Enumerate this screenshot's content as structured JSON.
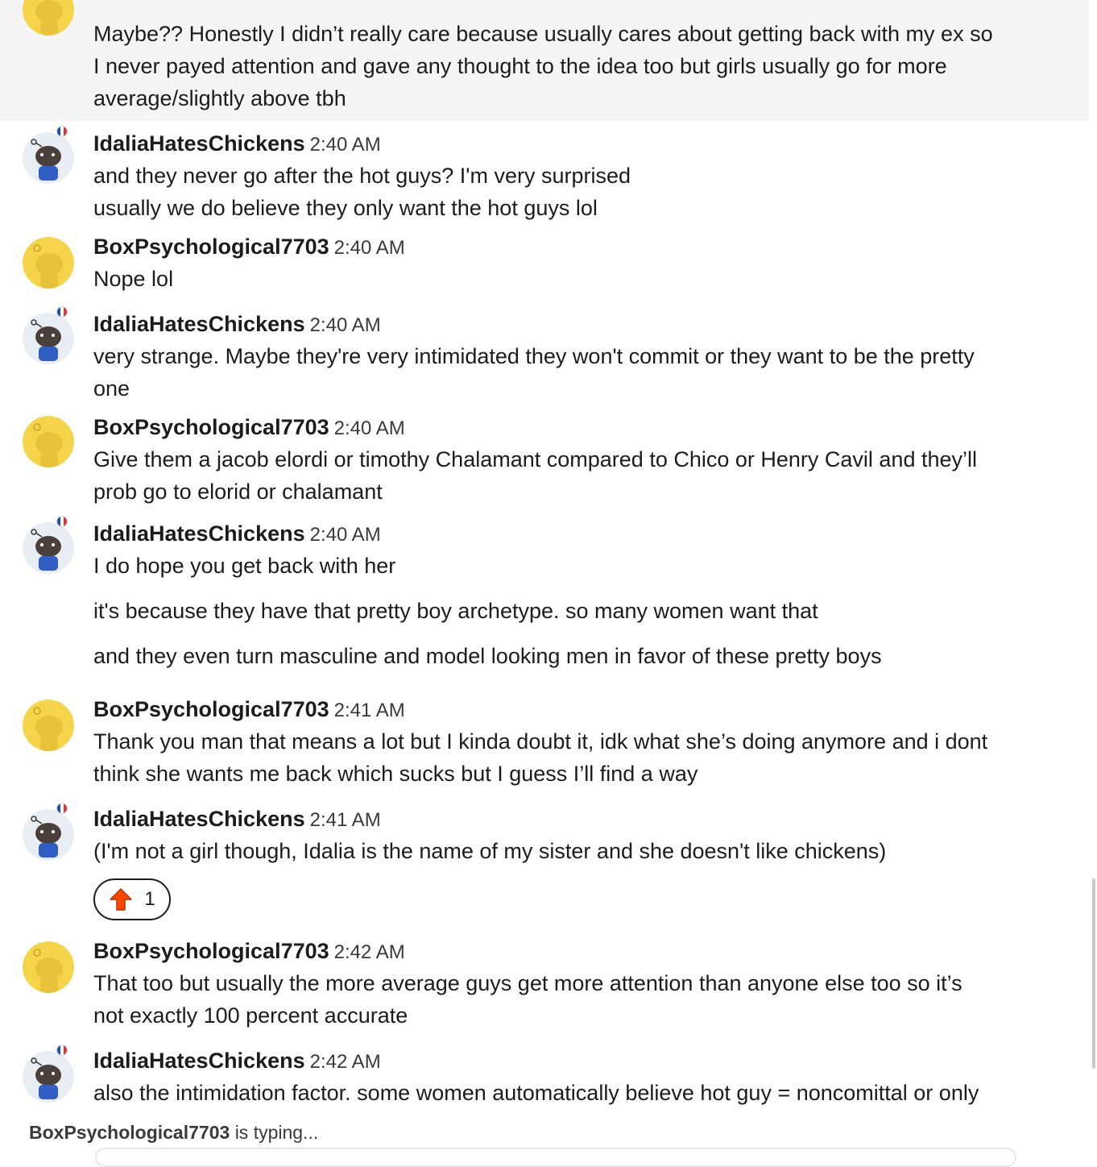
{
  "messages": [
    {
      "user": "",
      "time": "",
      "lines": [
        "Maybe?? Honestly I didn’t really care because usually cares about getting back with my ex so",
        "I never payed attention and gave any thought to the idea too but girls usually go for more",
        "average/slightly above tbh"
      ],
      "avatar": "yellow"
    },
    {
      "user": "IdaliaHatesChickens",
      "time": "2:40 AM",
      "lines": [
        "and they never go after the hot guys? I'm very surprised",
        "usually we do believe they only want the hot guys lol"
      ],
      "avatar": "bear"
    },
    {
      "user": "BoxPsychological7703",
      "time": "2:40 AM",
      "lines": [
        "Nope lol"
      ],
      "avatar": "yellow"
    },
    {
      "user": "IdaliaHatesChickens",
      "time": "2:40 AM",
      "lines": [
        "very strange. Maybe they're very intimidated they won't commit or they want to be the pretty",
        "one"
      ],
      "avatar": "bear"
    },
    {
      "user": "BoxPsychological7703",
      "time": "2:40 AM",
      "lines": [
        "Give them a jacob elordi or timothy Chalamant compared to Chico or Henry Cavil and they’ll",
        "prob go to elorid or chalamant"
      ],
      "avatar": "yellow"
    },
    {
      "user": "IdaliaHatesChickens",
      "time": "2:40 AM",
      "lines": [
        "I do hope you get back with her",
        "it's because they have that pretty boy archetype. so many women want that",
        "and they even turn masculine and model looking men in favor of these pretty boys"
      ],
      "avatar": "bear"
    },
    {
      "user": "BoxPsychological7703",
      "time": "2:41 AM",
      "lines": [
        "Thank you man that means a lot but I kinda doubt it, idk what she’s doing anymore and i dont",
        "think she wants me back which sucks but I guess I’ll find a way"
      ],
      "avatar": "yellow"
    },
    {
      "user": "IdaliaHatesChickens",
      "time": "2:41 AM",
      "lines": [
        "(I'm not a girl though, Idalia is the name of my sister and she doesn't like chickens)"
      ],
      "avatar": "bear",
      "reaction": {
        "icon": "upvote-icon",
        "count": "1"
      }
    },
    {
      "user": "BoxPsychological7703",
      "time": "2:42 AM",
      "lines": [
        "That too but usually the more average guys get more attention than anyone else too so it’s",
        "not exactly 100 percent accurate"
      ],
      "avatar": "yellow"
    },
    {
      "user": "IdaliaHatesChickens",
      "time": "2:42 AM",
      "lines": [
        "also the intimidation factor. some women automatically believe hot guy = noncomittal or only"
      ],
      "avatar": "bear"
    }
  ],
  "typing": {
    "user": "BoxPsychological7703",
    "suffix": "is typing..."
  },
  "colors": {
    "yellow_avatar": "#f5d44a",
    "bear_bg": "#e8eef3",
    "upvote": "#ff4500"
  }
}
